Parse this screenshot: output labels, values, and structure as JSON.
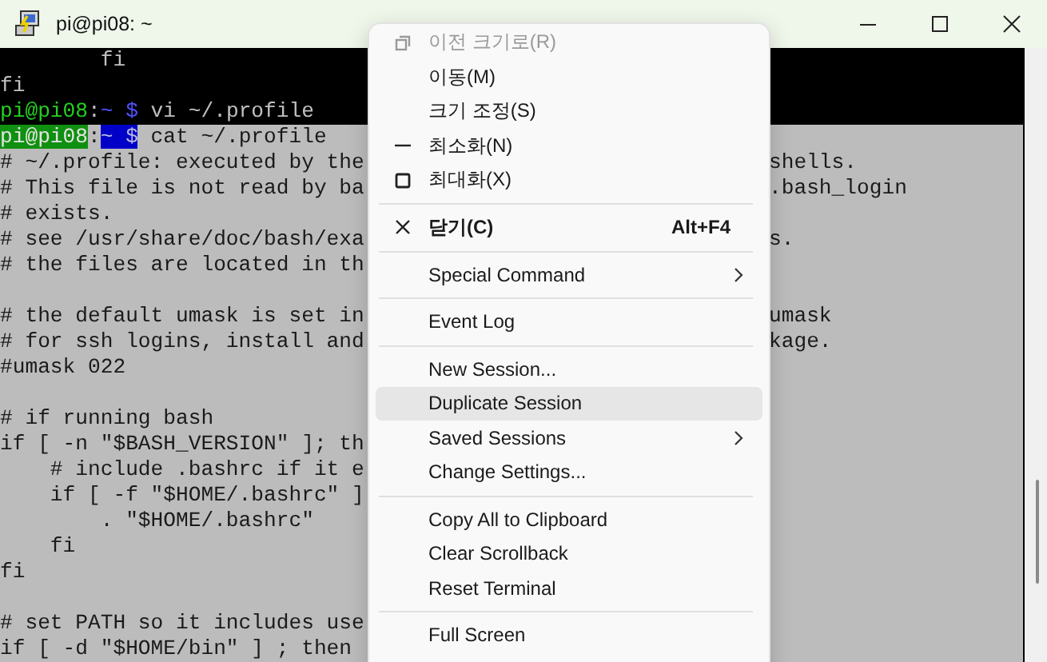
{
  "window": {
    "title": "pi@pi08: ~"
  },
  "terminal": {
    "scrollback": [
      {
        "kind": "text",
        "text": "        fi"
      },
      {
        "kind": "text",
        "text": "fi"
      },
      {
        "kind": "prompt",
        "user": "pi@pi08",
        "sep": ":",
        "path": "~ $",
        "command": " vi ~/.profile"
      }
    ],
    "selection": [
      {
        "kind": "prompt",
        "user": "pi@pi08",
        "sep": ":",
        "path": "~ $",
        "command": " cat ~/.profile"
      },
      {
        "kind": "text",
        "text": "# ~/.profile: executed by the",
        "tail": "shells."
      },
      {
        "kind": "text",
        "text": "# This file is not read by ba",
        "tail": ".bash_login"
      },
      {
        "kind": "text",
        "text": "# exists."
      },
      {
        "kind": "text",
        "text": "# see /usr/share/doc/bash/exa",
        "tail": "s."
      },
      {
        "kind": "text",
        "text": "# the files are located in th"
      },
      {
        "kind": "blank"
      },
      {
        "kind": "text",
        "text": "# the default umask is set in",
        "tail": "umask"
      },
      {
        "kind": "text",
        "text": "# for ssh logins, install and",
        "tail": "kage."
      },
      {
        "kind": "text",
        "text": "#umask 022"
      },
      {
        "kind": "blank"
      },
      {
        "kind": "text",
        "text": "# if running bash"
      },
      {
        "kind": "text",
        "text": "if [ -n \"$BASH_VERSION\" ]; th"
      },
      {
        "kind": "text",
        "text": "    # include .bashrc if it e"
      },
      {
        "kind": "text",
        "text": "    if [ -f \"$HOME/.bashrc\" ]"
      },
      {
        "kind": "text",
        "text": "        . \"$HOME/.bashrc\""
      },
      {
        "kind": "text",
        "text": "    fi"
      },
      {
        "kind": "text",
        "text": "fi"
      },
      {
        "kind": "blank"
      },
      {
        "kind": "text",
        "text": "# set PATH so it includes use"
      },
      {
        "kind": "text",
        "text": "if [ -d \"$HOME/bin\" ] ; then"
      }
    ]
  },
  "context_menu": [
    {
      "kind": "item",
      "label": "이전 크기로(R)",
      "disabled": true,
      "selected": false,
      "default": false,
      "submenu": false
    },
    {
      "kind": "item",
      "label": "이동(M)",
      "disabled": false,
      "selected": false,
      "default": false,
      "submenu": false
    },
    {
      "kind": "item",
      "label": "크기 조정(S)",
      "disabled": false,
      "selected": false,
      "default": false,
      "submenu": false
    },
    {
      "kind": "item",
      "label": "최소화(N)",
      "disabled": false,
      "selected": false,
      "default": false,
      "submenu": false
    },
    {
      "kind": "item",
      "label": "최대화(X)",
      "disabled": false,
      "selected": false,
      "default": false,
      "submenu": false
    },
    {
      "kind": "separator"
    },
    {
      "kind": "item",
      "label": "닫기(C)",
      "shortcut": "Alt+F4",
      "disabled": false,
      "selected": false,
      "default": true,
      "submenu": false
    },
    {
      "kind": "separator"
    },
    {
      "kind": "item",
      "label": "Special Command",
      "disabled": false,
      "selected": false,
      "default": false,
      "submenu": true
    },
    {
      "kind": "separator"
    },
    {
      "kind": "item",
      "label": "Event Log",
      "disabled": false,
      "selected": false,
      "default": false,
      "submenu": false
    },
    {
      "kind": "separator"
    },
    {
      "kind": "item",
      "label": "New Session...",
      "disabled": false,
      "selected": false,
      "default": false,
      "submenu": false
    },
    {
      "kind": "item",
      "label": "Duplicate Session",
      "disabled": false,
      "selected": true,
      "default": false,
      "submenu": false
    },
    {
      "kind": "item",
      "label": "Saved Sessions",
      "disabled": false,
      "selected": false,
      "default": false,
      "submenu": true
    },
    {
      "kind": "item",
      "label": "Change Settings...",
      "disabled": false,
      "selected": false,
      "default": false,
      "submenu": false
    },
    {
      "kind": "separator"
    },
    {
      "kind": "item",
      "label": "Copy All to Clipboard",
      "disabled": false,
      "selected": false,
      "default": false,
      "submenu": false
    },
    {
      "kind": "item",
      "label": "Clear Scrollback",
      "disabled": false,
      "selected": false,
      "default": false,
      "submenu": false
    },
    {
      "kind": "item",
      "label": "Reset Terminal",
      "disabled": false,
      "selected": false,
      "default": false,
      "submenu": false
    },
    {
      "kind": "separator"
    },
    {
      "kind": "item",
      "label": "Full Screen",
      "disabled": false,
      "selected": false,
      "default": false,
      "submenu": false
    }
  ]
}
